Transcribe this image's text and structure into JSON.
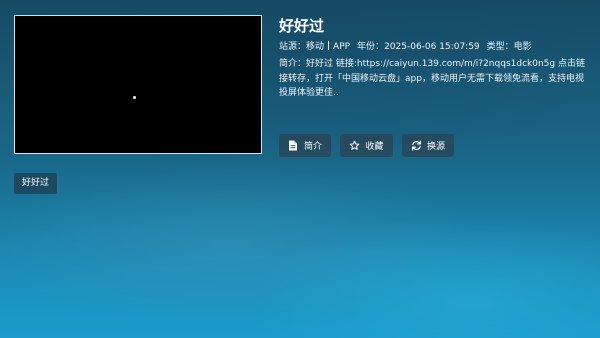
{
  "player": {},
  "detail": {
    "title": "好好过",
    "meta": {
      "site_label": "站源：",
      "site_value": "移动",
      "platform": "APP",
      "year_label": "年份：",
      "year_value": "2025-06-06 15:07:59",
      "type_label": "类型：",
      "type_value": "电影"
    },
    "description": "简介：好好过 链接:https://caiyun.139.com/m/i?2nqqs1dck0n5g 点击链接转存，打开「中国移动云盘」app，移动用户无需下载领免流看，支持电视投屏体验更佳.."
  },
  "actions": {
    "intro_label": "简介",
    "favorite_label": "收藏",
    "change_source_label": "换源"
  },
  "episodes": [
    {
      "label": "好好过"
    }
  ],
  "icons": {
    "intro": "document-icon",
    "favorite": "star-outline-icon",
    "change_source": "refresh-icon"
  }
}
